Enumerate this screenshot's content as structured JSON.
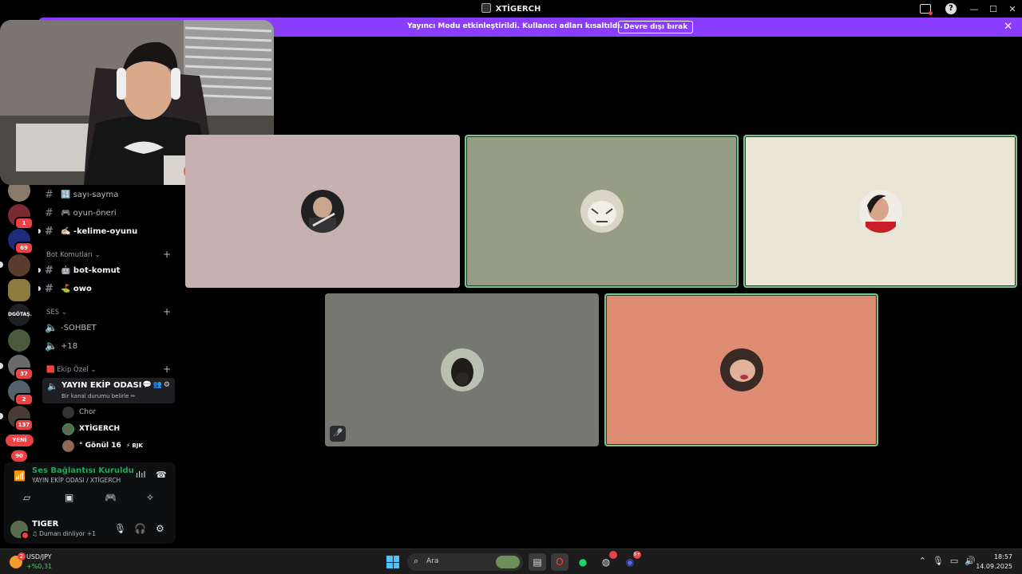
{
  "window": {
    "title": "XTİGERCH"
  },
  "banner": {
    "message": "Yayıncı Modu etkinleştirildi. Kullanıcı adları kısaltıldı.",
    "button_label": "Devre dışı bırak"
  },
  "servers": [
    {
      "badge": ""
    },
    {
      "badge": "1"
    },
    {
      "badge": "69"
    },
    {
      "badge": ""
    },
    {
      "badge": ""
    },
    {
      "badge": ""
    },
    {
      "badge": ""
    },
    {
      "badge": "37"
    },
    {
      "badge": "2"
    },
    {
      "badge": "137"
    },
    {
      "badge": "90"
    }
  ],
  "server_text": {
    "dg_label": "DGÖTAŞ.",
    "new_label": "YENİ"
  },
  "channels": {
    "items": [
      {
        "name": "🔢 sayı-sayma"
      },
      {
        "name": "🎮 oyun-öneri"
      },
      {
        "name": "✍🏻 -kelime-oyunu"
      }
    ],
    "bot_category": "Bot Komutları",
    "bot_items": [
      {
        "name": "🤖 bot-komut"
      },
      {
        "name": "⛳ owo"
      }
    ],
    "voice_category": "SES",
    "voice_items": [
      {
        "name": "-SOHBET"
      },
      {
        "name": "+18"
      }
    ],
    "team_category": "🟥 Ekip Özel",
    "active_channel": {
      "name": "YAYIN EKİP ODASI",
      "status": "Bir kanal durumu belirle ✏"
    },
    "members": [
      {
        "name": "Chor"
      },
      {
        "name": "XTİGERCH"
      },
      {
        "name": "° Gönül 16",
        "tag": "⚡ BJK"
      }
    ]
  },
  "voice_panel": {
    "title": "Ses Bağlantısı Kuruldu",
    "subtitle": "YAYIN EKİP ODASI / XTİGERCH"
  },
  "user": {
    "name": "TIGER",
    "status": "♫ Duman dinliyor +1"
  },
  "tiles": [
    {
      "bg": "#c7b0b0",
      "speaking": false
    },
    {
      "bg": "#979c84",
      "speaking": true
    },
    {
      "bg": "#e9e6d6",
      "speaking": true
    },
    {
      "bg": "#777772",
      "speaking": false,
      "muted": true
    },
    {
      "bg": "#df8c75",
      "speaking": true
    }
  ],
  "taskbar": {
    "widget_pair": "USD/JPY",
    "widget_change": "+%0,31",
    "widget_badge": "2",
    "search_placeholder": "Ara",
    "discord_badge": "9+",
    "time": "18:57",
    "date": "14.09.2025"
  },
  "colors": {
    "accent": "#8b3dff",
    "speaking": "#7cc38e",
    "connected": "#23a55a",
    "badge": "#ed4245"
  }
}
